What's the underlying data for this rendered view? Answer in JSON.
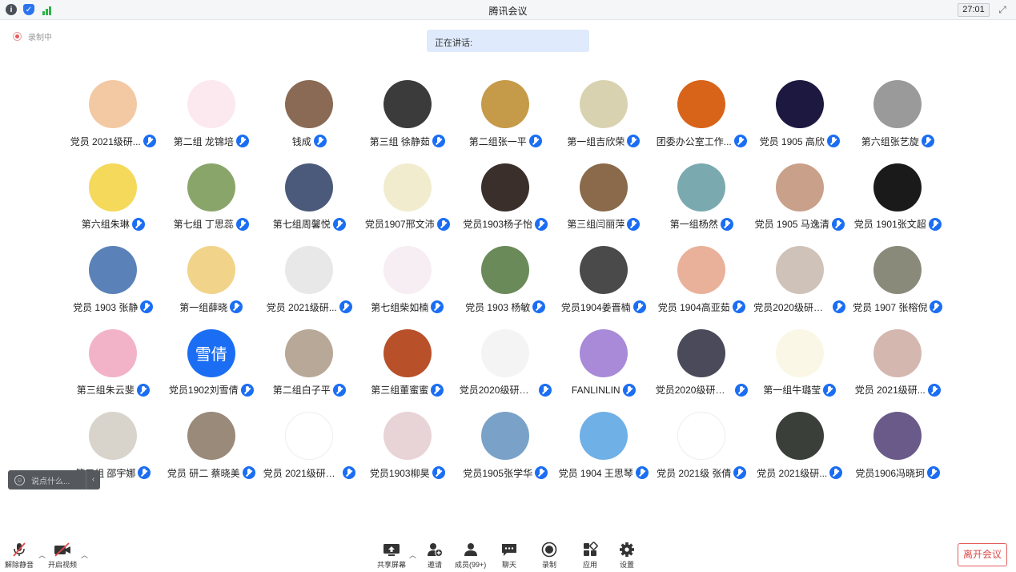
{
  "window": {
    "title": "腾讯会议",
    "timer": "27:01",
    "icons": [
      "info-icon",
      "shield-icon",
      "signal-icon",
      "fullscreen-icon"
    ]
  },
  "recording": {
    "label": "录制中"
  },
  "speaking": {
    "label": "正在讲话:"
  },
  "participants": [
    {
      "name": "党员  2021级研...",
      "avatar_color": "#f3c9a3",
      "avatar_text": ""
    },
    {
      "name": "第二组 龙锦培",
      "avatar_color": "#fbe9ef",
      "avatar_text": ""
    },
    {
      "name": "钱成",
      "avatar_color": "#8a6a55",
      "avatar_text": ""
    },
    {
      "name": "第三组 徐静茹",
      "avatar_color": "#3b3b3b",
      "avatar_text": ""
    },
    {
      "name": "第二组张一平",
      "avatar_color": "#c59a48",
      "avatar_text": ""
    },
    {
      "name": "第一组吉欣荣",
      "avatar_color": "#d9d2b0",
      "avatar_text": ""
    },
    {
      "name": "团委办公室工作...",
      "avatar_color": "#d8641a",
      "avatar_text": ""
    },
    {
      "name": "党员 1905 高欣",
      "avatar_color": "#1d1840",
      "avatar_text": ""
    },
    {
      "name": "第六组张艺旋",
      "avatar_color": "#9a9a9a",
      "avatar_text": ""
    },
    {
      "name": "第六组朱琳",
      "avatar_color": "#f4d95a",
      "avatar_text": ""
    },
    {
      "name": "第七组 丁思蕊",
      "avatar_color": "#8aa56a",
      "avatar_text": ""
    },
    {
      "name": "第七组周馨悦",
      "avatar_color": "#4b5a7a",
      "avatar_text": ""
    },
    {
      "name": "党员1907邢文沛",
      "avatar_color": "#f2eccf",
      "avatar_text": ""
    },
    {
      "name": "党员1903杨子怡",
      "avatar_color": "#3a2f2a",
      "avatar_text": ""
    },
    {
      "name": "第三组闫丽萍",
      "avatar_color": "#8a6a4a",
      "avatar_text": ""
    },
    {
      "name": "第一组杨然",
      "avatar_color": "#7aaab0",
      "avatar_text": ""
    },
    {
      "name": "党员 1905 马逸清",
      "avatar_color": "#c9a08a",
      "avatar_text": ""
    },
    {
      "name": "党员 1901张文超",
      "avatar_color": "#1a1a1a",
      "avatar_text": ""
    },
    {
      "name": "党员 1903 张静",
      "avatar_color": "#5a82b8",
      "avatar_text": ""
    },
    {
      "name": "第一组薛晓",
      "avatar_color": "#f1d48a",
      "avatar_text": ""
    },
    {
      "name": "党员  2021级研...",
      "avatar_color": "#e8e8e8",
      "avatar_text": ""
    },
    {
      "name": "第七组柴如楠",
      "avatar_color": "#f6eef2",
      "avatar_text": ""
    },
    {
      "name": "党员 1903 杨敏",
      "avatar_color": "#6a8a5a",
      "avatar_text": ""
    },
    {
      "name": "党员1904姜晋楠",
      "avatar_color": "#4a4a4a",
      "avatar_text": ""
    },
    {
      "name": "党员  1904高亚茹",
      "avatar_color": "#e9b19a",
      "avatar_text": ""
    },
    {
      "name": "党员2020级研究...",
      "avatar_color": "#cfc2b8",
      "avatar_text": ""
    },
    {
      "name": "党员 1907 张榕倪",
      "avatar_color": "#8a8a7a",
      "avatar_text": ""
    },
    {
      "name": "第三组朱云斐",
      "avatar_color": "#f2b3c8",
      "avatar_text": ""
    },
    {
      "name": "党员1902刘雪倩",
      "avatar_color": "#1b6ef3",
      "avatar_text": "雪倩"
    },
    {
      "name": "第二组白子平",
      "avatar_color": "#b8a898",
      "avatar_text": ""
    },
    {
      "name": "第三组董蜜蜜",
      "avatar_color": "#b8502a",
      "avatar_text": ""
    },
    {
      "name": "党员2020级研究...",
      "avatar_color": "#f4f4f4",
      "avatar_text": ""
    },
    {
      "name": "FANLINLIN",
      "avatar_color": "#a88ad8",
      "avatar_text": ""
    },
    {
      "name": "党员2020级研究...",
      "avatar_color": "#4a4a5a",
      "avatar_text": ""
    },
    {
      "name": "第一组牛璐莹",
      "avatar_color": "#fbf7e6",
      "avatar_text": ""
    },
    {
      "name": "党员 2021级研...",
      "avatar_color": "#d4b8b0",
      "avatar_text": ""
    },
    {
      "name": "第三组 邵宇娜",
      "avatar_color": "#d8d4cc",
      "avatar_text": ""
    },
    {
      "name": "党员  研二 蔡晓美",
      "avatar_color": "#9a8a7a",
      "avatar_text": ""
    },
    {
      "name": "党员 2021级研究生...",
      "avatar_color": "#ffffff",
      "avatar_text": ""
    },
    {
      "name": "党员1903柳昊",
      "avatar_color": "#e8d4d6",
      "avatar_text": ""
    },
    {
      "name": "党员1905张学华",
      "avatar_color": "#7aa2c8",
      "avatar_text": ""
    },
    {
      "name": "党员 1904  王思琴",
      "avatar_color": "#6fb0e6",
      "avatar_text": ""
    },
    {
      "name": "党员 2021级 张倩",
      "avatar_color": "#ffffff",
      "avatar_text": ""
    },
    {
      "name": "党员 2021级研...",
      "avatar_color": "#3a3f3a",
      "avatar_text": ""
    },
    {
      "name": "党员1906冯晓珂",
      "avatar_color": "#6a5a8a",
      "avatar_text": ""
    }
  ],
  "chat": {
    "placeholder": "说点什么..."
  },
  "toolbar": {
    "unmute": "解除静音",
    "video": "开启视频",
    "share": "共享屏幕",
    "invite": "邀请",
    "members": "成员(99+)",
    "chat": "聊天",
    "record": "录制",
    "apps": "应用",
    "settings": "设置",
    "leave": "离开会议"
  }
}
